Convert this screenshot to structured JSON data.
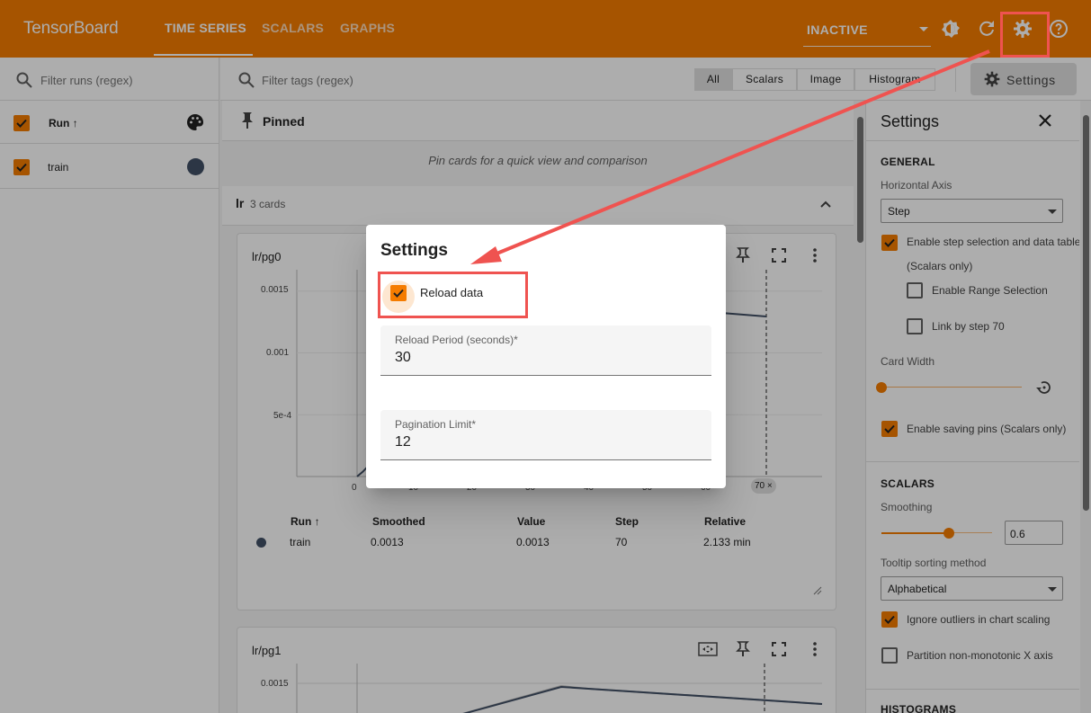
{
  "header": {
    "brand": "TensorBoard",
    "tabs": [
      {
        "label": "TIME SERIES"
      },
      {
        "label": "SCALARS"
      },
      {
        "label": "GRAPHS"
      }
    ],
    "status": "INACTIVE"
  },
  "runs": {
    "filter_placeholder": "Filter runs (regex)",
    "header_label": "Run ↑",
    "rows": [
      {
        "name": "train",
        "color": "#425066"
      }
    ]
  },
  "toolbar": {
    "filter_placeholder": "Filter tags (regex)",
    "segments": [
      "All",
      "Scalars",
      "Image",
      "Histogram"
    ],
    "settings_label": "Settings"
  },
  "pinned": {
    "label": "Pinned",
    "hint": "Pin cards for a quick view and comparison"
  },
  "group": {
    "name": "lr",
    "count": "3 cards"
  },
  "cards": [
    {
      "title": "lr/pg0",
      "y_ticks": [
        "0.0015",
        "0.001",
        "5e-4",
        ""
      ],
      "x_ticks": [
        "0",
        "0",
        "10",
        "20",
        "30",
        "40",
        "50",
        "60"
      ],
      "step_badge": "70 ×",
      "table": {
        "headers": [
          "Run ↑",
          "Smoothed",
          "Value",
          "Step",
          "Relative"
        ],
        "row": {
          "run": "train",
          "smoothed": "0.0013",
          "value": "0.0013",
          "step": "70",
          "relative": "2.133 min"
        }
      }
    },
    {
      "title": "lr/pg1",
      "y_ticks": [
        "0.0015"
      ]
    }
  ],
  "chart_data": [
    {
      "type": "line",
      "title": "lr/pg0",
      "x": [
        0,
        1,
        2
      ],
      "series": [
        {
          "values": [
            0,
            4e-05,
            9e-05
          ]
        }
      ],
      "ylim": [
        0,
        0.0016
      ],
      "x_ticks": [
        0,
        10,
        20,
        30,
        40,
        50,
        60
      ],
      "y_ticks": [
        0.0015,
        0.001,
        0.0005
      ],
      "step_marker": 70,
      "xlabel": "",
      "ylabel": ""
    }
  ],
  "settings_panel": {
    "title": "Settings",
    "general": {
      "heading": "GENERAL",
      "horizontal_axis_label": "Horizontal Axis",
      "horizontal_axis_value": "Step",
      "step_selection_label": "Enable step selection and data table",
      "step_selection_sub": "(Scalars only)",
      "range_selection_label": "Enable Range Selection",
      "link_by_step_label": "Link by step 70",
      "card_width_label": "Card Width",
      "saving_pins_label": "Enable saving pins (Scalars only)"
    },
    "scalars": {
      "heading": "SCALARS",
      "smoothing_label": "Smoothing",
      "smoothing_value": "0.6",
      "tooltip_label": "Tooltip sorting method",
      "tooltip_value": "Alphabetical",
      "ignore_outliers_label": "Ignore outliers in chart scaling",
      "partition_label": "Partition non-monotonic X axis"
    },
    "histograms_heading": "HISTOGRAMS"
  },
  "dialog": {
    "title": "Settings",
    "reload_label": "Reload data",
    "reload_period_label": "Reload Period (seconds)*",
    "reload_period_value": "30",
    "pagination_label": "Pagination Limit*",
    "pagination_value": "12"
  },
  "colors": {
    "accent": "#f57c00",
    "highlight": "#ef5350",
    "run_color": "#425066"
  }
}
